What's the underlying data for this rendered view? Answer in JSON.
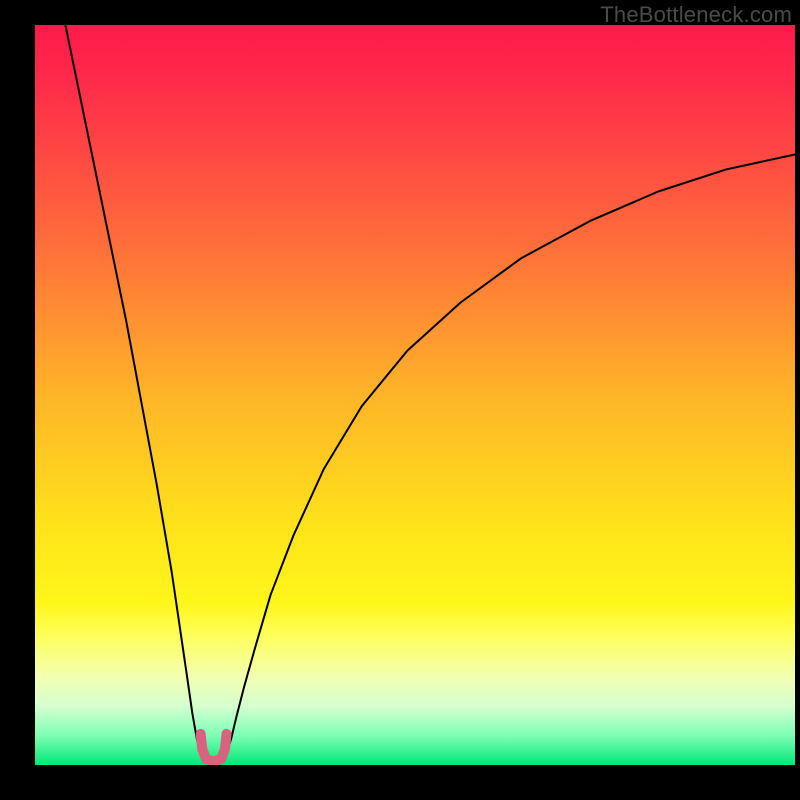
{
  "watermark": "TheBottleneck.com",
  "chart_data": {
    "type": "line",
    "title": "",
    "xlabel": "",
    "ylabel": "",
    "xlim": [
      0,
      100
    ],
    "ylim": [
      0,
      100
    ],
    "grid": false,
    "legend": false,
    "annotations": [],
    "background_gradient": {
      "stops": [
        {
          "offset": 0.0,
          "color": "#ff1a4b"
        },
        {
          "offset": 0.08,
          "color": "#ff2b4a"
        },
        {
          "offset": 0.3,
          "color": "#ff6f3a"
        },
        {
          "offset": 0.5,
          "color": "#ffb428"
        },
        {
          "offset": 0.68,
          "color": "#ffe31a"
        },
        {
          "offset": 0.78,
          "color": "#fff61a"
        },
        {
          "offset": 0.83,
          "color": "#fdff63"
        },
        {
          "offset": 0.88,
          "color": "#f3ffb0"
        },
        {
          "offset": 0.92,
          "color": "#d6ffd0"
        },
        {
          "offset": 0.96,
          "color": "#7dffb4"
        },
        {
          "offset": 1.0,
          "color": "#00e878"
        }
      ]
    },
    "series": [
      {
        "name": "left-branch",
        "color": "#000000",
        "width": 2,
        "x": [
          4.0,
          6.0,
          8.0,
          10.0,
          12.0,
          14.0,
          16.0,
          18.0,
          19.0,
          20.0,
          20.7,
          21.3,
          21.8
        ],
        "y": [
          100.0,
          90.0,
          80.0,
          70.0,
          60.0,
          49.0,
          38.0,
          26.0,
          19.0,
          12.0,
          7.0,
          3.5,
          1.6
        ]
      },
      {
        "name": "right-branch",
        "color": "#000000",
        "width": 2,
        "x": [
          25.2,
          25.8,
          26.5,
          27.5,
          29.0,
          31.0,
          34.0,
          38.0,
          43.0,
          49.0,
          56.0,
          64.0,
          73.0,
          82.0,
          91.0,
          100.0
        ],
        "y": [
          1.6,
          3.5,
          6.5,
          10.5,
          16.0,
          23.0,
          31.0,
          40.0,
          48.5,
          56.0,
          62.5,
          68.5,
          73.5,
          77.5,
          80.5,
          82.5
        ]
      },
      {
        "name": "valley-marker",
        "color": "#d9627e",
        "width": 10,
        "linecap": "round",
        "x": [
          21.8,
          22.0,
          22.5,
          23.5,
          24.5,
          25.0,
          25.2
        ],
        "y": [
          4.2,
          2.2,
          0.8,
          0.5,
          0.8,
          2.2,
          4.2
        ]
      }
    ]
  }
}
